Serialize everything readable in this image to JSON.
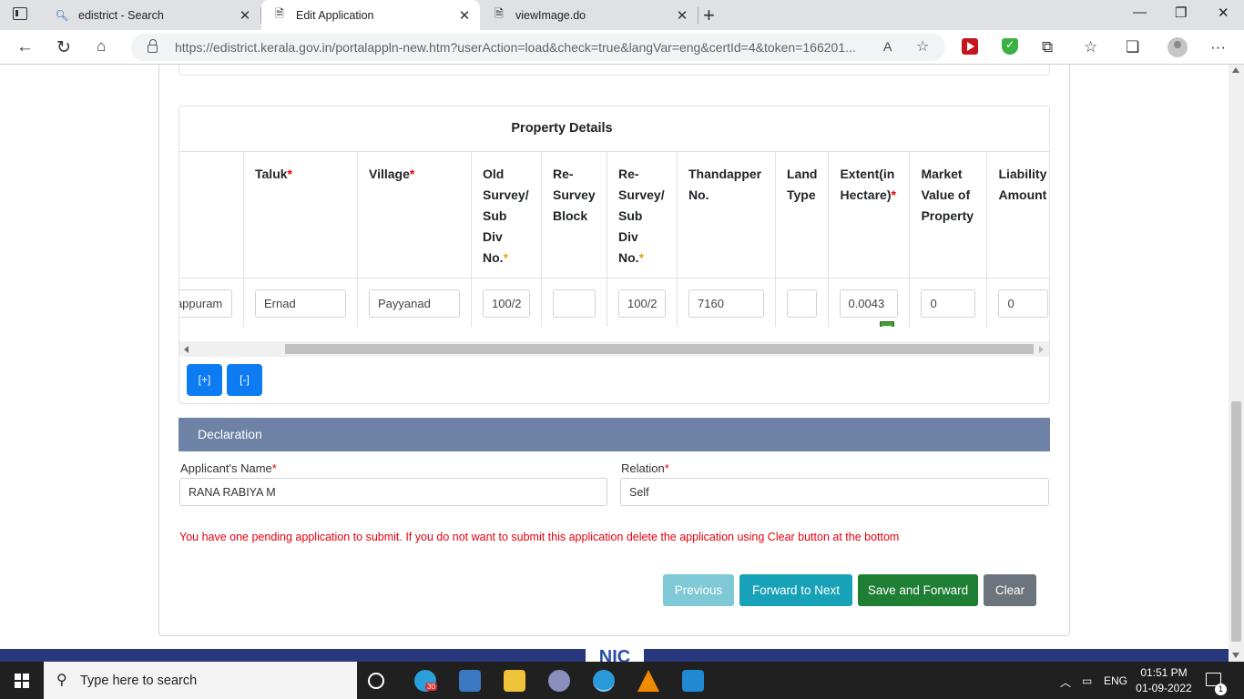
{
  "browser": {
    "tabs": [
      {
        "title": "edistrict - Search",
        "icon": "search-icon"
      },
      {
        "title": "Edit Application",
        "icon": "page-icon"
      },
      {
        "title": "viewImage.do",
        "icon": "page-icon"
      }
    ],
    "url": "https://edistrict.kerala.gov.in/portalappln-new.htm?userAction=load&check=true&langVar=eng&certId=4&token=166201..."
  },
  "property_details": {
    "title": "Property Details",
    "columns": [
      {
        "label": "",
        "required": true
      },
      {
        "label": "Taluk",
        "required": true
      },
      {
        "label": "Village",
        "required": true
      },
      {
        "label": "Old Survey/ Sub Div No.",
        "required": true
      },
      {
        "label": "Re-Survey Block",
        "required": false
      },
      {
        "label": "Re-Survey/ Sub Div No.",
        "required": true
      },
      {
        "label": "Thandapper No.",
        "required": false
      },
      {
        "label": "Land Type",
        "required": false
      },
      {
        "label": "Extent(in Hectare)",
        "required": true
      },
      {
        "label": "Market Value of Property",
        "required": false
      },
      {
        "label": "Liability Amount",
        "required": false
      }
    ],
    "row": {
      "district": "Malappuram",
      "taluk": "Ernad",
      "village": "Payyanad",
      "old_survey": "100/2",
      "resurvey_block": "",
      "resurvey_subdiv": "100/2",
      "thandapper": "7160",
      "land_type": "",
      "extent": "0.0043",
      "market_value": "0",
      "liability": "0"
    },
    "add_label": "[+]",
    "remove_label": "[-]"
  },
  "declaration": {
    "title": "Declaration",
    "applicant_label": "Applicant's Name",
    "applicant_value": "RANA RABIYA M",
    "relation_label": "Relation",
    "relation_value": "Self"
  },
  "warning": "You have one pending application to submit. If you do not want to submit this application delete the application using Clear button at the bottom",
  "actions": {
    "previous": "Previous",
    "forward": "Forward to Next",
    "save": "Save and Forward",
    "clear": "Clear"
  },
  "footer_logo": "NIC",
  "taskbar": {
    "search_placeholder": "Type here to search",
    "telegram_badge": "30",
    "language": "ENG",
    "time": "01:51 PM",
    "date": "01-09-2022",
    "notifications": "1"
  },
  "colors": {
    "declaration_header": "#6e82a5",
    "warning": "#e5000f",
    "primary_button": "#0d7cf2"
  }
}
